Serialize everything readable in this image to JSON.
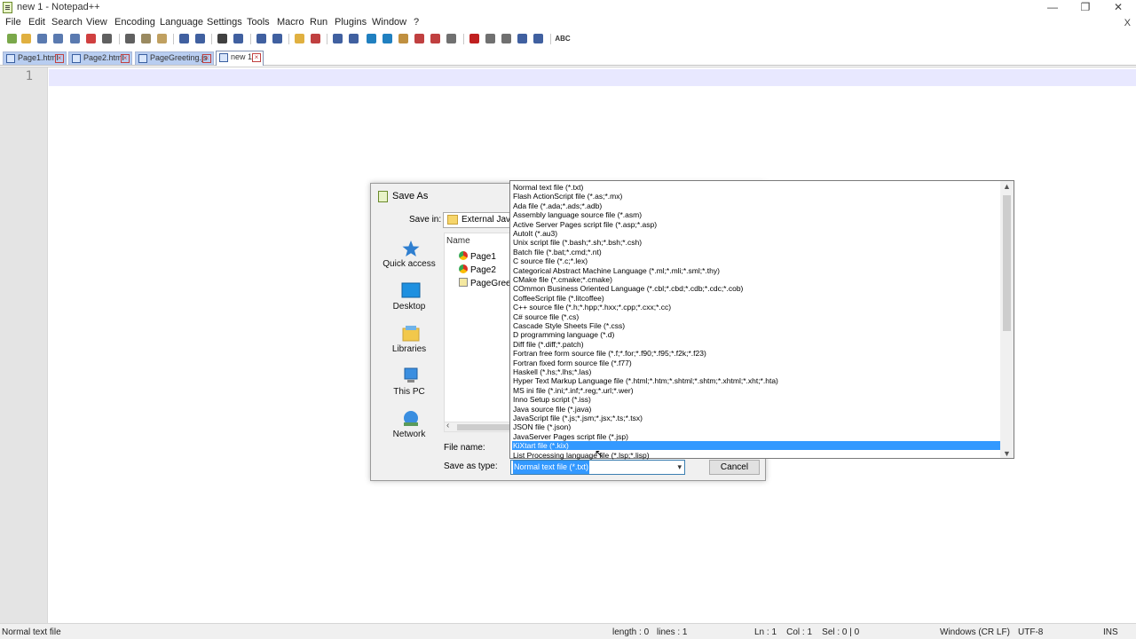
{
  "window": {
    "title": "new 1 - Notepad++",
    "minimize_glyph": "—",
    "restore_glyph": "❐",
    "close_glyph": "✕",
    "secondary_close": "X"
  },
  "menu": [
    "File",
    "Edit",
    "Search",
    "View",
    "Encoding",
    "Language",
    "Settings",
    "Tools",
    "Macro",
    "Run",
    "Plugins",
    "Window",
    "?"
  ],
  "toolbar": {
    "colors": [
      "#7aa84a",
      "#e0b040",
      "#5a7ab0",
      "#5a7ab0",
      "#5a7ab0",
      "#d04040",
      "#606060",
      "#606060",
      "#9a8a60",
      "#c0a060",
      "#4060a0",
      "#4060a0",
      "#404040",
      "#4060a0",
      "#4060a0",
      "#4060a0",
      "#e0b040",
      "#c04040",
      "#4060a0",
      "#4060a0",
      "#2080c0",
      "#2080c0",
      "#c09040",
      "#c04040",
      "#c04040",
      "#707070",
      "#c02020",
      "#707070",
      "#707070",
      "#4060a0",
      "#4060a0",
      "#806040"
    ],
    "spell_label": "ABC"
  },
  "tabs": [
    {
      "label": "Page1.html",
      "active": false
    },
    {
      "label": "Page2.html",
      "active": false
    },
    {
      "label": "PageGreeting.js",
      "active": false
    },
    {
      "label": "new 1",
      "active": true
    }
  ],
  "editor": {
    "line_number": "1"
  },
  "status": {
    "file_type": "Normal text file",
    "length": "length : 0",
    "lines": "lines : 1",
    "position": "Ln : 1    Col : 1    Sel : 0 | 0",
    "eol": "Windows (CR LF)",
    "encoding": "UTF-8",
    "mode": "INS"
  },
  "dialog": {
    "title": "Save As",
    "save_in_label": "Save in:",
    "save_in_value": "External JavaS",
    "places": [
      "Quick access",
      "Desktop",
      "Libraries",
      "This PC",
      "Network"
    ],
    "list_header": "Name",
    "files": [
      "Page1",
      "Page2",
      "PageGreet"
    ],
    "file_name_label": "File name:",
    "save_as_type_label": "Save as type:",
    "save_as_type_value": "Normal text file (*.txt)",
    "cancel_label": "Cancel"
  },
  "dropdown": {
    "selected_index": 28,
    "items": [
      "Normal text file (*.txt)",
      "Flash ActionScript file (*.as;*.mx)",
      "Ada file (*.ada;*.ads;*.adb)",
      "Assembly language source file (*.asm)",
      "Active Server Pages script file (*.asp;*.asp)",
      "AutoIt (*.au3)",
      "Unix script file (*.bash;*.sh;*.bsh;*.csh)",
      "Batch file (*.bat;*.cmd;*.nt)",
      "C source file (*.c;*.lex)",
      "Categorical Abstract Machine Language (*.ml;*.mli;*.sml;*.thy)",
      "CMake file (*.cmake;*.cmake)",
      "COmmon Business Oriented Language (*.cbl;*.cbd;*.cdb;*.cdc;*.cob)",
      "CoffeeScript file (*.litcoffee)",
      "C++ source file (*.h;*.hpp;*.hxx;*.cpp;*.cxx;*.cc)",
      "C# source file (*.cs)",
      "Cascade Style Sheets File (*.css)",
      "D programming language (*.d)",
      "Diff file (*.diff;*.patch)",
      "Fortran free form source file (*.f;*.for;*.f90;*.f95;*.f2k;*.f23)",
      "Fortran fixed form source file (*.f77)",
      "Haskell (*.hs;*.lhs;*.las)",
      "Hyper Text Markup Language file (*.html;*.htm;*.shtml;*.shtm;*.xhtml;*.xht;*.hta)",
      "MS ini file (*.ini;*.inf;*.reg;*.url;*.wer)",
      "Inno Setup script (*.iss)",
      "Java source file (*.java)",
      "JavaScript file (*.js;*.jsm;*.jsx;*.ts;*.tsx)",
      "JSON file (*.json)",
      "JavaServer Pages script file (*.jsp)",
      "KiXtart file (*.kix)",
      "List Processing language file (*.lsp;*.lisp)"
    ]
  }
}
